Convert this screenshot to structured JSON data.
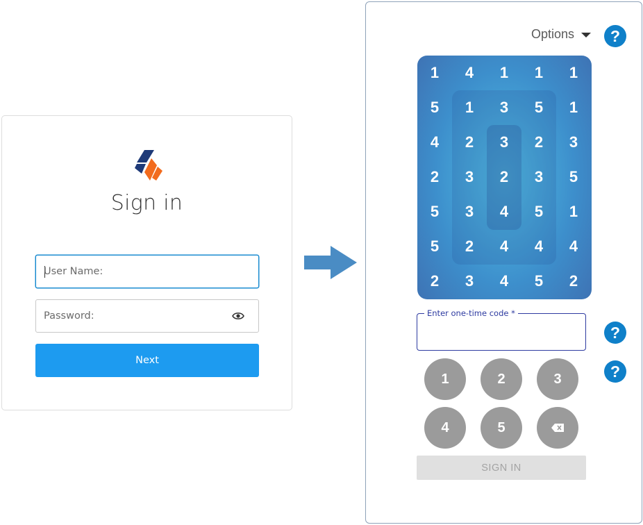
{
  "signin": {
    "title": "Sign in",
    "username_placeholder": "User Name:",
    "password_placeholder": "Password:",
    "next_label": "Next"
  },
  "panel": {
    "options_label": "Options",
    "otp_label": "Enter one-time code *",
    "signin_label": "SIGN IN",
    "keypad": [
      "1",
      "2",
      "3",
      "4",
      "5"
    ]
  },
  "grid": {
    "rows": [
      [
        "1",
        "4",
        "1",
        "1",
        "1"
      ],
      [
        "5",
        "1",
        "3",
        "5",
        "1"
      ],
      [
        "4",
        "2",
        "3",
        "2",
        "3"
      ],
      [
        "2",
        "3",
        "2",
        "3",
        "5"
      ],
      [
        "5",
        "3",
        "4",
        "5",
        "1"
      ],
      [
        "5",
        "2",
        "4",
        "4",
        "4"
      ],
      [
        "2",
        "3",
        "4",
        "5",
        "2"
      ]
    ]
  },
  "colors": {
    "primary_button": "#1d9bf0",
    "help_icon": "#0f80c9",
    "logo_blue": "#1e3a78",
    "logo_orange": "#f26b1d"
  },
  "icons": {
    "logo": "brand-logo-icon",
    "password_toggle": "eye-icon",
    "options_caret": "caret-down-icon",
    "help": "help-icon",
    "backspace": "backspace-icon",
    "arrow": "arrow-right-icon"
  }
}
